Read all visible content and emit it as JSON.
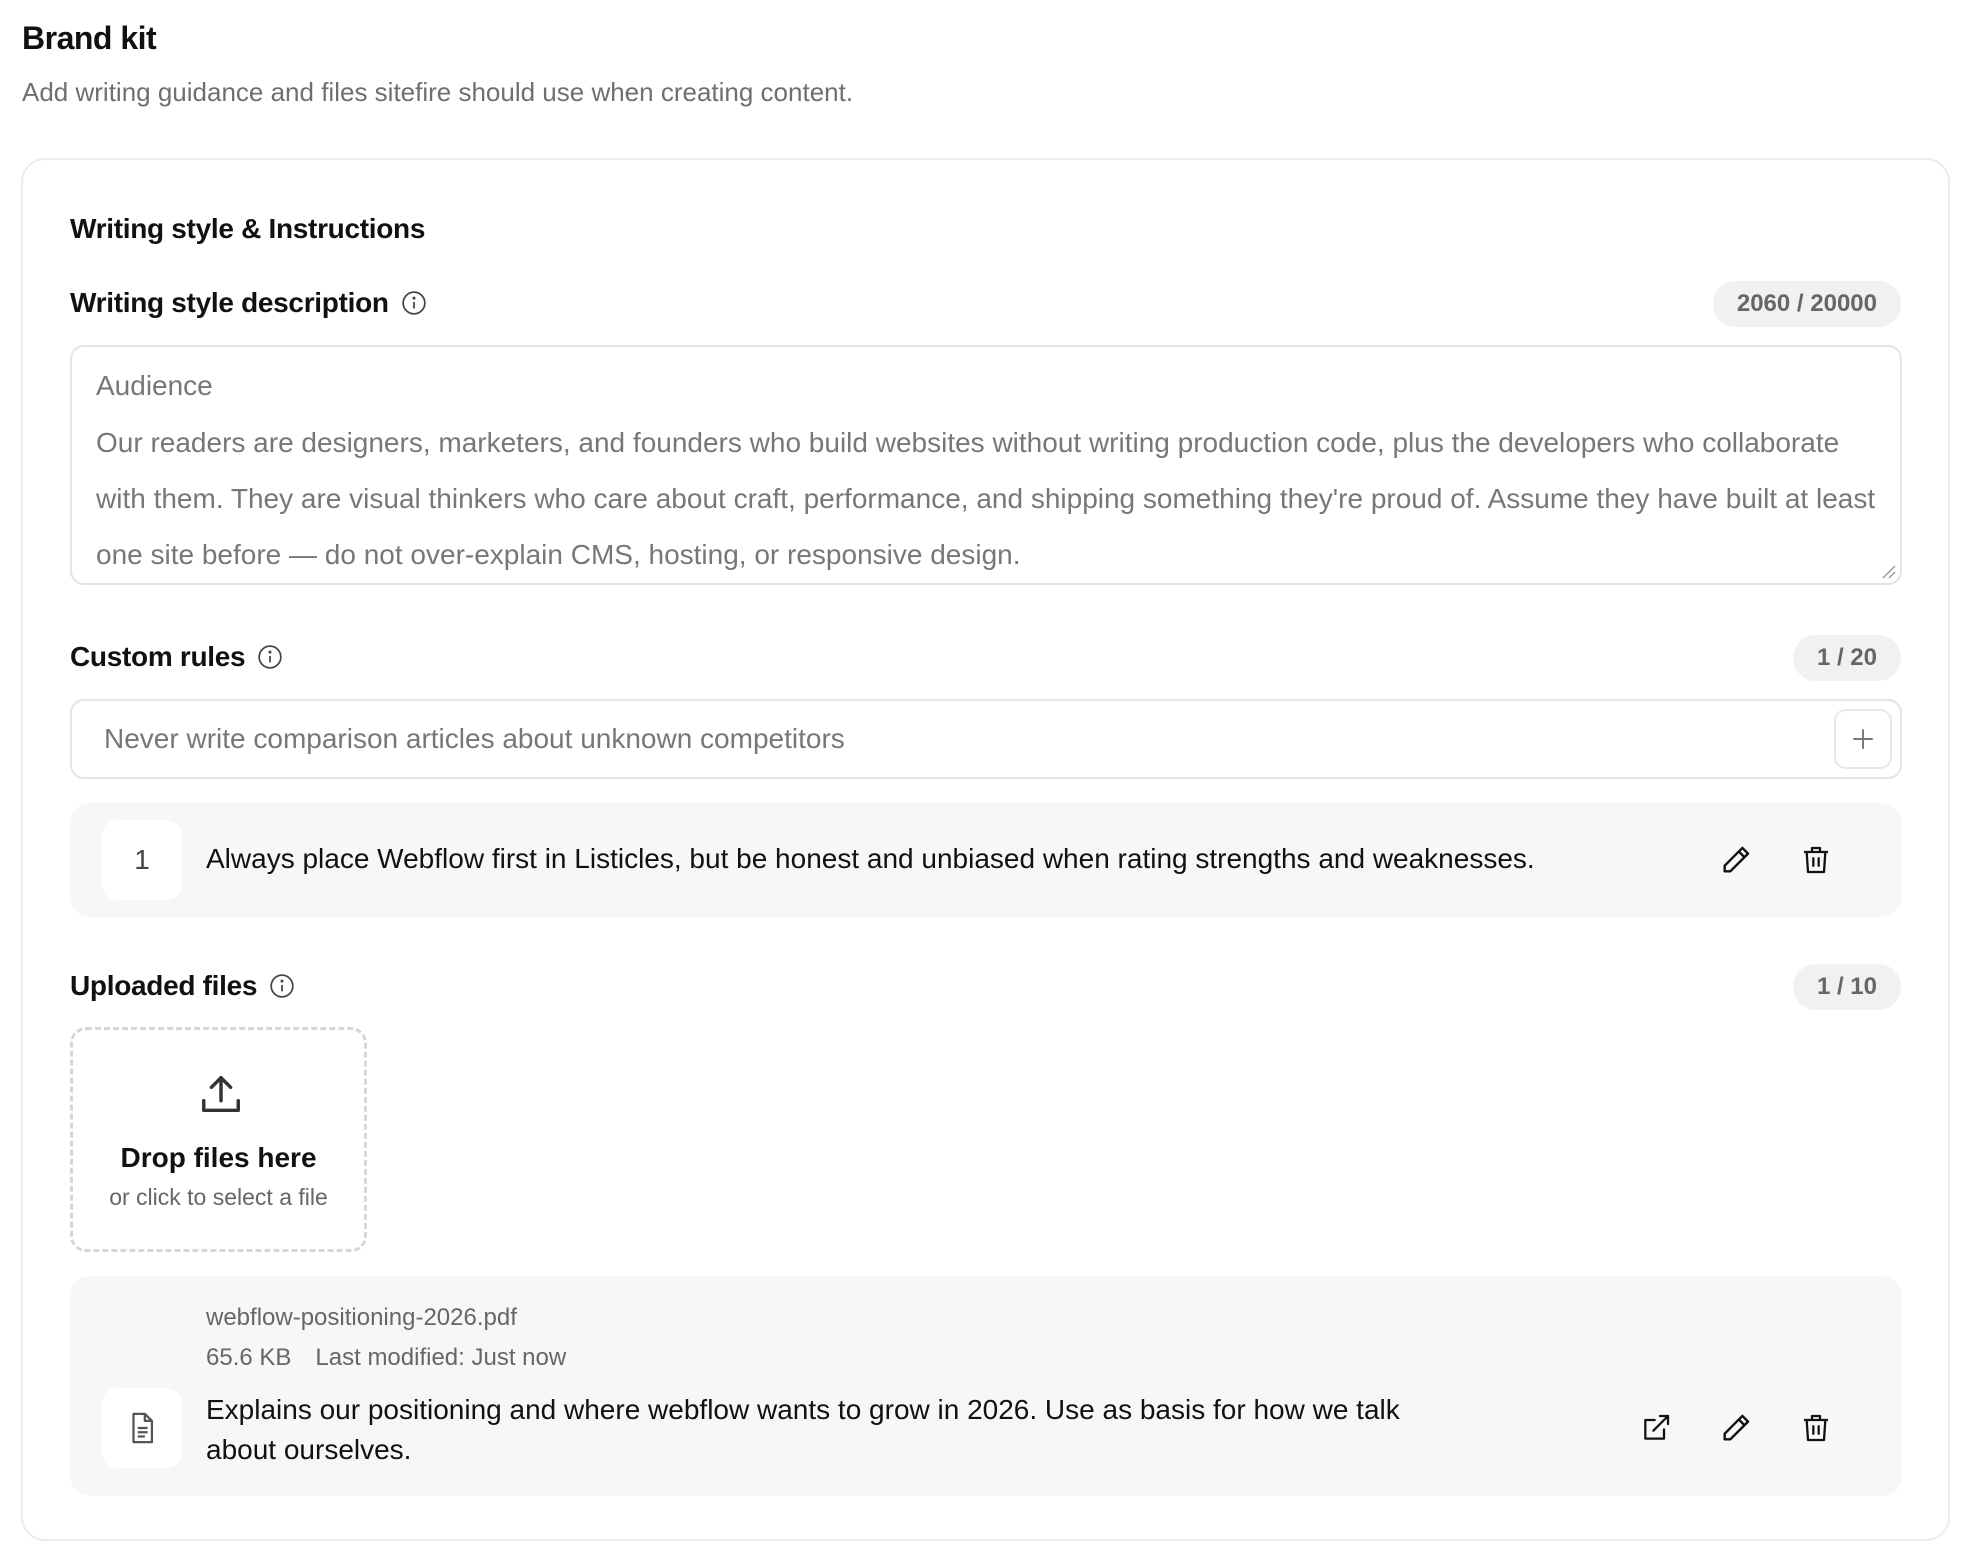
{
  "header": {
    "title": "Brand kit",
    "subtitle": "Add writing guidance and files sitefire should use when creating content."
  },
  "section": {
    "title": "Writing style & Instructions"
  },
  "writing_style": {
    "label": "Writing style description",
    "counter": "2060 / 20000",
    "lines": [
      "Audience",
      "Our readers are designers, marketers, and founders who build websites without writing production code, plus the developers who collaborate",
      "with them. They are visual thinkers who care about craft, performance, and shipping something they're proud of. Assume they have built at least",
      "one site before — do not over-explain CMS, hosting, or responsive design."
    ]
  },
  "custom_rules": {
    "label": "Custom rules",
    "counter": "1 / 20",
    "input_placeholder": "Never write comparison articles about unknown competitors",
    "rules": [
      {
        "number": "1",
        "text": "Always place Webflow first in Listicles, but be honest and unbiased when rating strengths and weaknesses."
      }
    ]
  },
  "uploaded_files": {
    "label": "Uploaded files",
    "counter": "1 / 10",
    "dropzone": {
      "title": "Drop files here",
      "subtitle": "or click to select a file"
    },
    "files": [
      {
        "name": "webflow-positioning-2026.pdf",
        "size": "65.6 KB",
        "modified": "Last modified: Just now",
        "description": "Explains our positioning and where webflow wants to grow in 2026. Use as basis for how we talk about ourselves."
      }
    ]
  },
  "icons": {
    "info": "info-icon",
    "plus": "plus-icon",
    "edit": "pencil-icon",
    "delete": "trash-icon",
    "upload": "upload-icon",
    "file": "document-icon",
    "external": "external-link-icon"
  }
}
